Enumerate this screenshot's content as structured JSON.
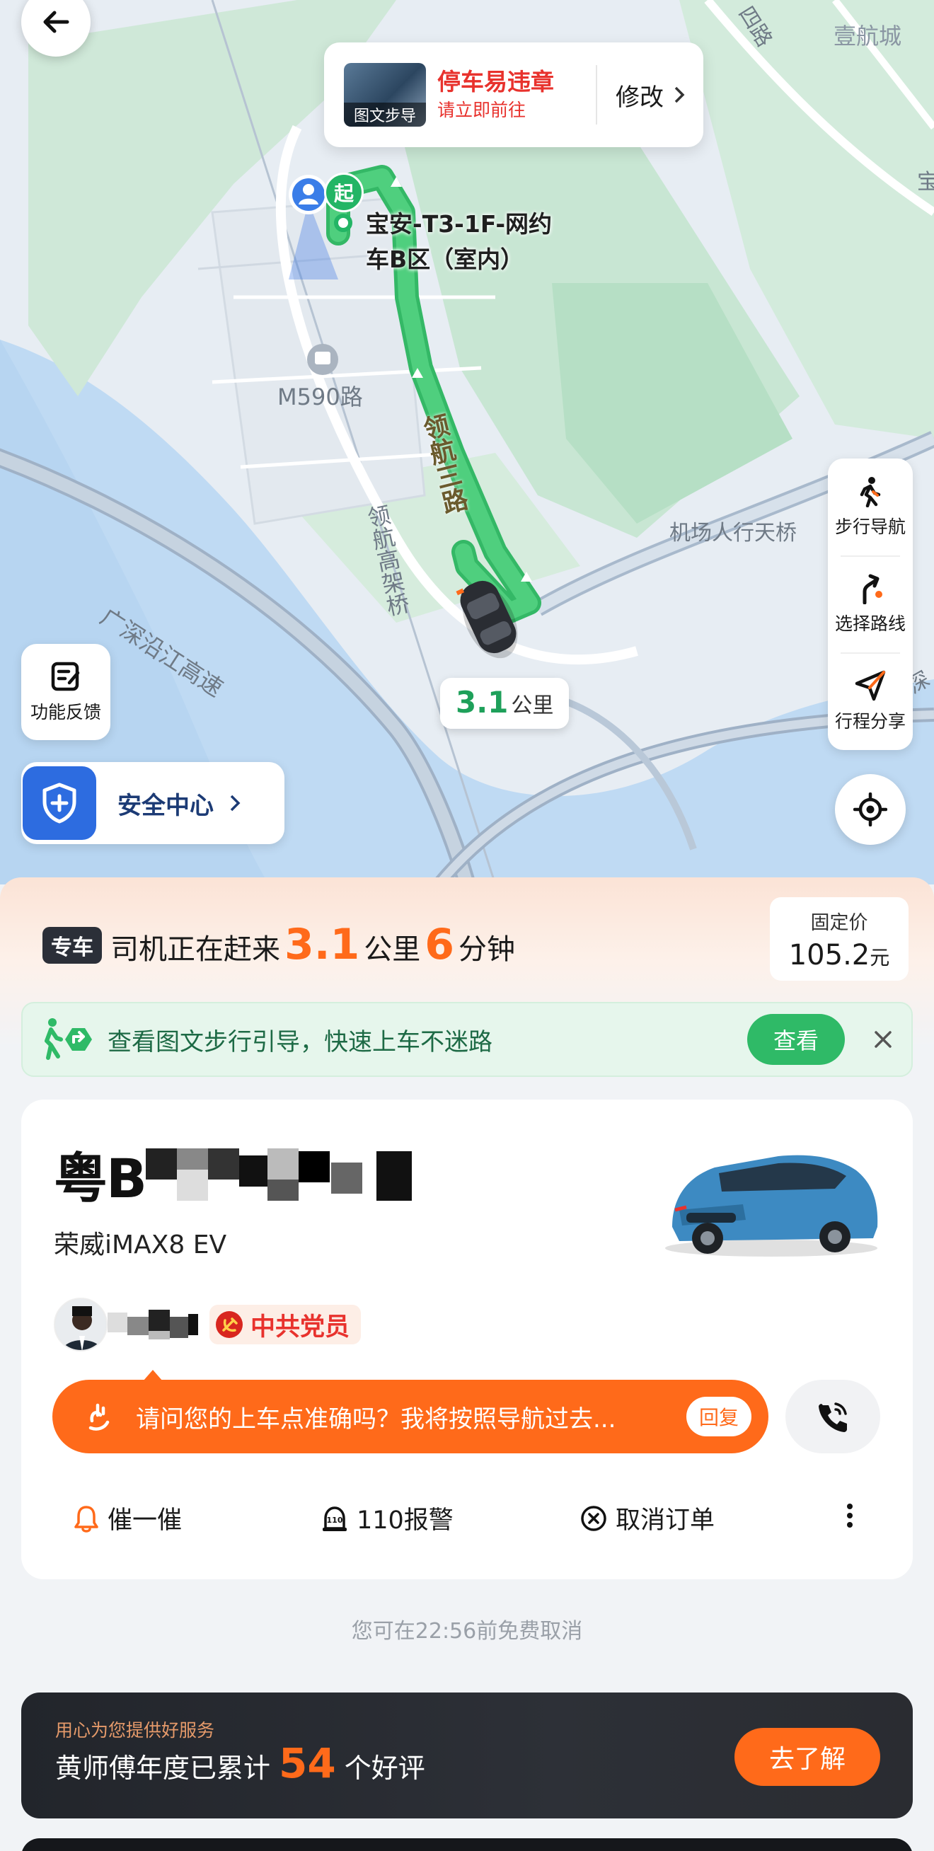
{
  "map": {
    "labels": {
      "top_right_road": "四路",
      "top_right_area": "壹航城",
      "stop": "M590路",
      "road_main": "领航三路",
      "road_elevated": "领航高架桥",
      "bridge": "机场人行天桥",
      "highway": "广深沿江高速",
      "edge_right": "宝",
      "edge_right2": "深"
    },
    "violation_card": {
      "thumb_caption": "图文步导",
      "title": "停车易违章",
      "subtitle": "请立即前往",
      "modify": "修改"
    },
    "start_badge": "起",
    "pickup_line1": "宝安-T3-1F-网约",
    "pickup_line2": "车B区（室内）",
    "distance_value": "3.1",
    "distance_unit": "公里",
    "tools": {
      "walk_nav": "步行导航",
      "select_route": "选择路线",
      "share_trip": "行程分享"
    },
    "feedback": "功能反馈",
    "safety_center": "安全中心"
  },
  "status": {
    "tag": "专车",
    "text1": "司机正在赶来",
    "distance": "3.1",
    "unit_km": "公里",
    "minutes": "6",
    "unit_min": "分钟"
  },
  "price": {
    "label": "固定价",
    "value": "105.2",
    "unit": "元"
  },
  "guide": {
    "text": "查看图文步行引导，快速上车不迷路",
    "view": "查看"
  },
  "driver": {
    "plate_prefix": "粤B",
    "car_model": "荣威iMAX8 EV",
    "party_badge": "中共党员",
    "message": "请问您的上车点准确吗？我将按照导航过去...",
    "reply": "回复"
  },
  "actions": {
    "urge": "催一催",
    "police": "110报警",
    "cancel": "取消订单"
  },
  "cancel_note": "您可在22:56前免费取消",
  "praise": {
    "sub": "用心为您提供好服务",
    "prefix": "黄师傅年度已累计",
    "count": "54",
    "suffix": "个好评",
    "button": "去了解"
  },
  "colors": {
    "accent_orange": "#ff6a1a",
    "route_green": "#3cc46f",
    "safety_blue": "#2d6ce0",
    "alert_red": "#e8322d"
  }
}
